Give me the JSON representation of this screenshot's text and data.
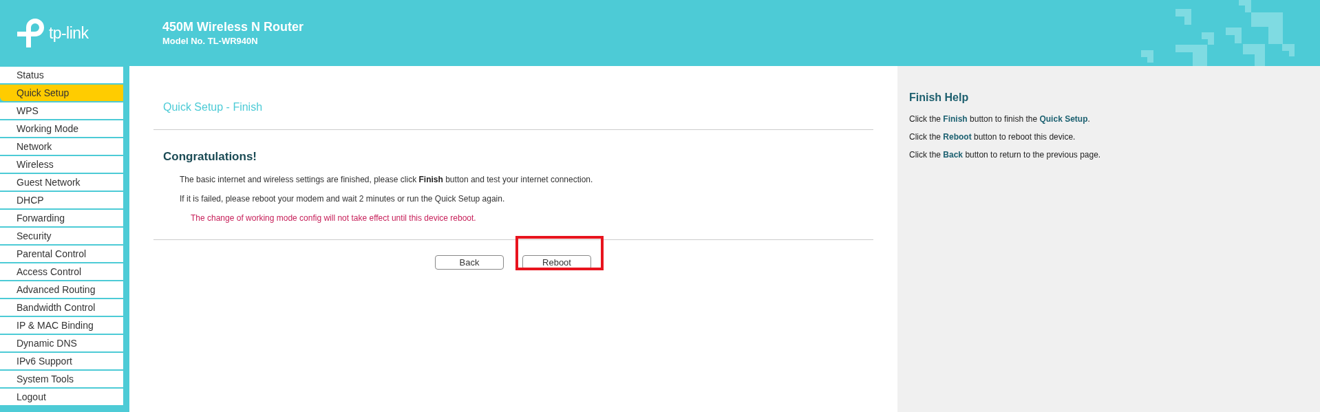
{
  "header": {
    "logo": "tp-link",
    "product": "450M Wireless N Router",
    "model": "Model No. TL-WR940N"
  },
  "sidebar": {
    "items": [
      {
        "label": "Status",
        "selected": false
      },
      {
        "label": "Quick Setup",
        "selected": true
      },
      {
        "label": "WPS",
        "selected": false
      },
      {
        "label": "Working Mode",
        "selected": false
      },
      {
        "label": "Network",
        "selected": false
      },
      {
        "label": "Wireless",
        "selected": false
      },
      {
        "label": "Guest Network",
        "selected": false
      },
      {
        "label": "DHCP",
        "selected": false
      },
      {
        "label": "Forwarding",
        "selected": false
      },
      {
        "label": "Security",
        "selected": false
      },
      {
        "label": "Parental Control",
        "selected": false
      },
      {
        "label": "Access Control",
        "selected": false
      },
      {
        "label": "Advanced Routing",
        "selected": false
      },
      {
        "label": "Bandwidth Control",
        "selected": false
      },
      {
        "label": "IP & MAC Binding",
        "selected": false
      },
      {
        "label": "Dynamic DNS",
        "selected": false
      },
      {
        "label": "IPv6 Support",
        "selected": false
      },
      {
        "label": "System Tools",
        "selected": false
      },
      {
        "label": "Logout",
        "selected": false
      }
    ]
  },
  "main": {
    "title": "Quick Setup - Finish",
    "heading": "Congratulations!",
    "paragraphs": [
      {
        "kind": "normal",
        "text": "The basic internet and wireless settings are finished, please click **Finish** button and test your internet connection."
      },
      {
        "kind": "normal",
        "text": "If it is failed, please reboot your modem and wait 2 minutes or run the Quick Setup again."
      },
      {
        "kind": "warning",
        "text": "The change of working mode config will not take effect until this device reboot."
      }
    ],
    "buttons": [
      {
        "label": "Back",
        "highlighted": false
      },
      {
        "label": "Reboot",
        "highlighted": true
      }
    ]
  },
  "help": {
    "title": "Finish Help",
    "lines": [
      "Click the **Finish** button to finish the **Quick Setup**.",
      "Click the **Reboot** button to reboot this device.",
      "Click the **Back** button to return to the previous page."
    ]
  }
}
